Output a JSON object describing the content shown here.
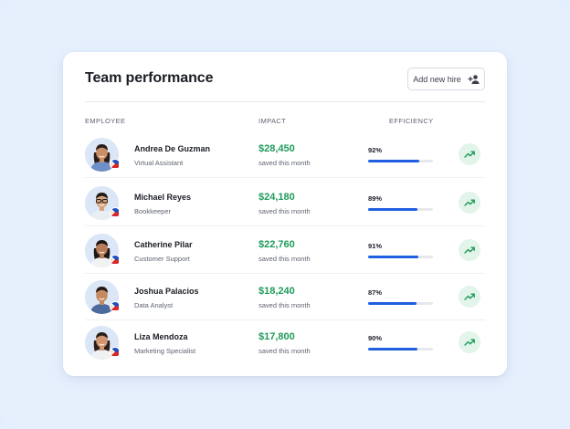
{
  "card": {
    "title": "Team performance",
    "add_button_label": "Add new hire"
  },
  "columns": {
    "employee": "EMPLOYEE",
    "impact": "IMPACT",
    "efficiency": "EFFICIENCY"
  },
  "icons": {
    "add_user": "add-user-icon",
    "trend": "trending-up-icon",
    "flag": "philippines-flag-icon"
  },
  "colors": {
    "impact_green": "#1f9a5a",
    "bar_blue": "#1f5fe0",
    "trend_bg": "#e3f4ea"
  },
  "rows": [
    {
      "name": "Andrea De Guzman",
      "role": "Virtual Assistant",
      "impact": "$28,450",
      "impact_sub": "saved this month",
      "efficiency": "92%",
      "efficiency_value": 0.92
    },
    {
      "name": "Michael Reyes",
      "role": "Bookkeeper",
      "impact": "$24,180",
      "impact_sub": "saved this month",
      "efficiency": "89%",
      "efficiency_value": 0.89
    },
    {
      "name": "Catherine Pilar",
      "role": "Customer Support",
      "impact": "$22,760",
      "impact_sub": "saved this month",
      "efficiency": "91%",
      "efficiency_value": 0.91
    },
    {
      "name": "Joshua Palacios",
      "role": "Data Analyst",
      "impact": "$18,240",
      "impact_sub": "saved this month",
      "efficiency": "87%",
      "efficiency_value": 0.87
    },
    {
      "name": "Liza Mendoza",
      "role": "Marketing Specialist",
      "impact": "$17,800",
      "impact_sub": "saved this month",
      "efficiency": "90%",
      "efficiency_value": 0.9
    }
  ]
}
